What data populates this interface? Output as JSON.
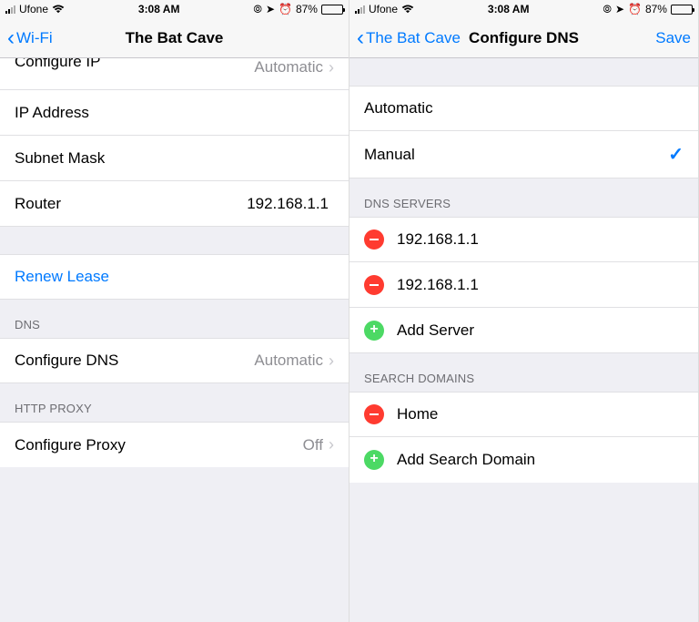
{
  "status_bar": {
    "carrier": "Ufone",
    "time": "3:08 AM",
    "battery_percent": "87%"
  },
  "left": {
    "nav": {
      "back_label": "Wi-Fi",
      "title": "The Bat Cave"
    },
    "cells": {
      "configure_ip_label": "Configure IP",
      "configure_ip_value": "Automatic",
      "ip_address_label": "IP Address",
      "subnet_mask_label": "Subnet Mask",
      "router_label": "Router",
      "router_value": "192.168.1.1",
      "renew_lease_label": "Renew Lease",
      "dns_header": "DNS",
      "configure_dns_label": "Configure DNS",
      "configure_dns_value": "Automatic",
      "proxy_header": "HTTP PROXY",
      "configure_proxy_label": "Configure Proxy",
      "configure_proxy_value": "Off"
    }
  },
  "right": {
    "nav": {
      "back_label": "The Bat Cave",
      "title": "Configure DNS",
      "save_label": "Save"
    },
    "options": {
      "automatic": "Automatic",
      "manual": "Manual"
    },
    "dns_header": "DNS SERVERS",
    "dns_servers": [
      "192.168.1.1",
      "192.168.1.1"
    ],
    "add_server_label": "Add Server",
    "search_header": "SEARCH DOMAINS",
    "search_domains": [
      "Home"
    ],
    "add_domain_label": "Add Search Domain"
  }
}
